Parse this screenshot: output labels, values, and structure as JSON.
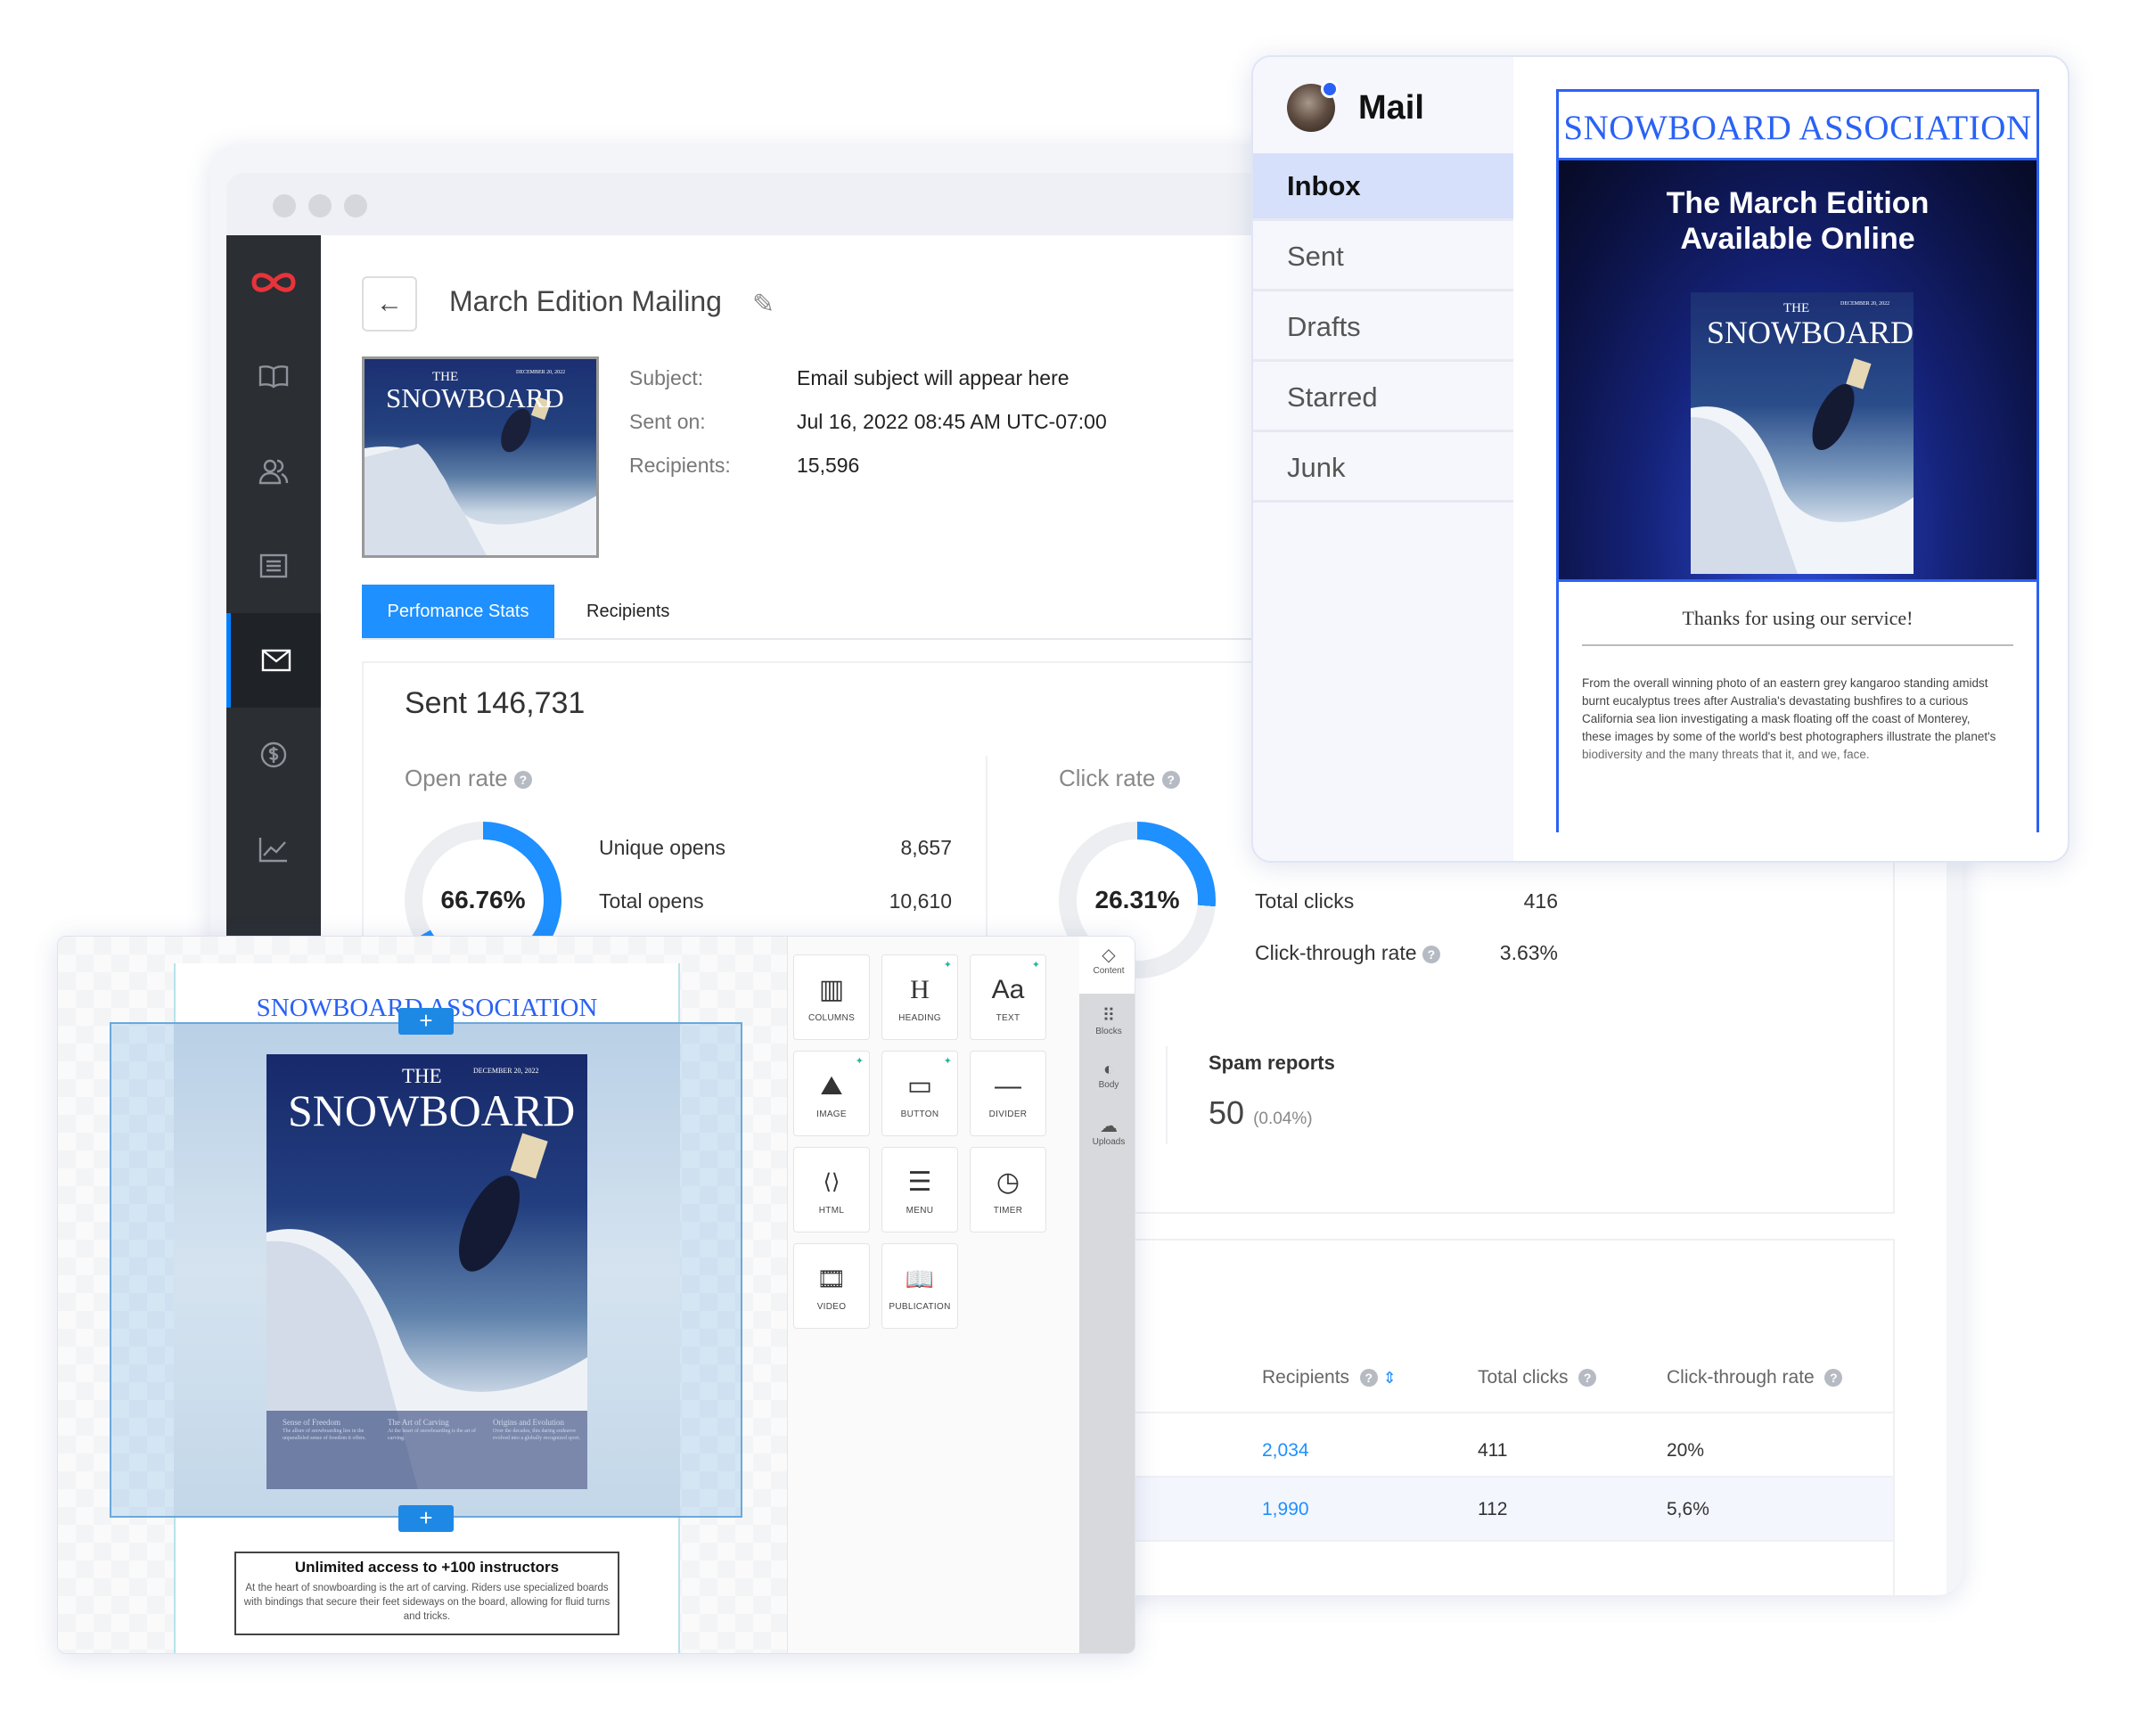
{
  "dashboard": {
    "title": "March Edition Mailing",
    "meta": [
      {
        "label": "Subject:",
        "value": "Email subject will appear here"
      },
      {
        "label": "Sent on:",
        "value": "Jul 16, 2022 08:45 AM UTC-07:00"
      },
      {
        "label": "Recipients:",
        "value": "15,596"
      }
    ],
    "tabs": [
      "Perfomance Stats",
      "Recipients"
    ],
    "sent": "Sent 146,731",
    "open_rate": {
      "label": "Open rate",
      "percent_text": "66.76%",
      "percent": 66.76,
      "stats": [
        {
          "label": "Unique opens",
          "value": "8,657"
        },
        {
          "label": "Total opens",
          "value": "10,610"
        }
      ]
    },
    "click_rate": {
      "label": "Click rate",
      "percent_text": "26.31%",
      "percent": 26.31,
      "stats": [
        {
          "label": "Total clicks",
          "value": "416"
        },
        {
          "label": "Click-through rate",
          "value": "3.63%"
        }
      ]
    },
    "spam": {
      "label": "Spam reports",
      "value": "50",
      "pct": "(0.04%)"
    },
    "table": {
      "headers": [
        "Recipients",
        "Total clicks",
        "Click-through rate"
      ],
      "rows": [
        [
          "2,034",
          "411",
          "20%"
        ],
        [
          "1,990",
          "112",
          "5,6%"
        ]
      ]
    },
    "nav_icons": [
      "logo-icon",
      "book-icon",
      "users-icon",
      "list-icon",
      "mail-icon",
      "dollar-icon",
      "chart-icon"
    ],
    "accent": "#1e90ff"
  },
  "mail": {
    "title": "Mail",
    "folders": [
      "Inbox",
      "Sent",
      "Drafts",
      "Starred",
      "Junk"
    ],
    "active_folder": "Inbox",
    "preview": {
      "association": "SNOWBOARD ASSOCIATION",
      "hero_line1": "The March Edition",
      "hero_line2": "Available Online",
      "thanks": "Thanks for using our service!",
      "body": "From the overall winning photo of an eastern grey kangaroo standing amidst burnt eucalyptus trees after Australia's devastating bushfires to a curious California sea lion investigating a mask floating off the coast of Monterey, these images by some of the world's best photographers illustrate the planet's biodiversity and the many threats that it, and we, face."
    },
    "accent": "#2a62f5"
  },
  "cover": {
    "the": "THE",
    "snowboard": "SNOWBOARD",
    "date": "DECEMBER 20, 2022",
    "captions": [
      {
        "title": "Sense of Freedom",
        "text": "The allure of snowboarding lies in the unparalleled sense of freedom it offers."
      },
      {
        "title": "The Art of Carving",
        "text": "At the heart of snowboarding is the art of carving."
      },
      {
        "title": "Origins and Evolution",
        "text": "Over the decades, this daring endeavor evolved into a globally recognized sport."
      }
    ]
  },
  "editor": {
    "association": "SNOWBOARD ASSOCIATION",
    "promo_title": "Unlimited access to +100 instructors",
    "promo_text": "At the heart of snowboarding is the art of carving. Riders use specialized boards with bindings that secure their feet sideways on the board, allowing for fluid turns and tricks.",
    "tools": [
      {
        "label": "COLUMNS",
        "icon": "columns-icon",
        "glyph": "▥"
      },
      {
        "label": "HEADING",
        "icon": "heading-icon",
        "glyph": "H"
      },
      {
        "label": "TEXT",
        "icon": "text-icon",
        "glyph": "Aa"
      },
      {
        "label": "IMAGE",
        "icon": "image-icon",
        "glyph": "⛰"
      },
      {
        "label": "BUTTON",
        "icon": "button-icon",
        "glyph": "▭"
      },
      {
        "label": "DIVIDER",
        "icon": "divider-icon",
        "glyph": "—"
      },
      {
        "label": "HTML",
        "icon": "html-icon",
        "glyph": "⟨⟩"
      },
      {
        "label": "MENU",
        "icon": "menu-icon",
        "glyph": "☰"
      },
      {
        "label": "TIMER",
        "icon": "timer-icon",
        "glyph": "◷"
      },
      {
        "label": "VIDEO",
        "icon": "video-icon",
        "glyph": "🎞"
      },
      {
        "label": "PUBLICATION",
        "icon": "publication-icon",
        "glyph": "📖"
      }
    ],
    "rail": [
      {
        "label": "Content",
        "icon": "content-icon",
        "glyph": "◇"
      },
      {
        "label": "Blocks",
        "icon": "blocks-icon",
        "glyph": "⠿"
      },
      {
        "label": "Body",
        "icon": "palette-icon",
        "glyph": "◐"
      },
      {
        "label": "Uploads",
        "icon": "upload-icon",
        "glyph": "☁"
      }
    ]
  }
}
